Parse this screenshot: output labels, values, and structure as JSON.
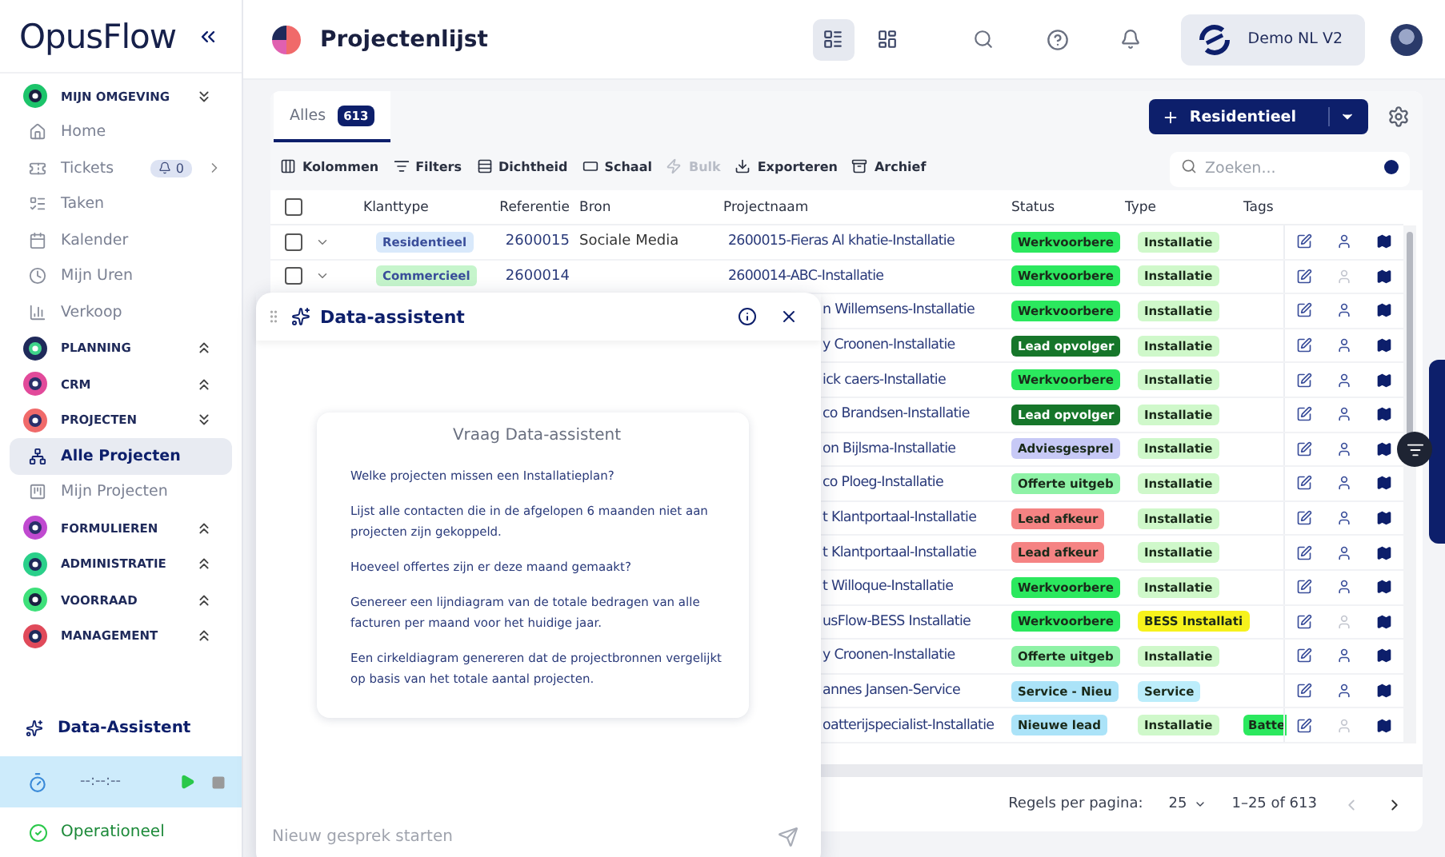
{
  "sidebar": {
    "logo": "OpusFlow",
    "sections": [
      {
        "label": "MIJN OMGEVING",
        "expanded": true,
        "children": [
          {
            "label": "Home",
            "selected": false
          },
          {
            "label": "Tickets",
            "selected": false,
            "badge": "0"
          },
          {
            "label": "Taken",
            "selected": false
          },
          {
            "label": "Kalender",
            "selected": false
          },
          {
            "label": "Mijn Uren",
            "selected": false
          },
          {
            "label": "Verkoop",
            "selected": false
          }
        ]
      },
      {
        "label": "PLANNING",
        "expanded": false
      },
      {
        "label": "CRM",
        "expanded": false
      },
      {
        "label": "PROJECTEN",
        "expanded": true,
        "children": [
          {
            "label": "Alle Projecten",
            "selected": true
          },
          {
            "label": "Mijn Projecten",
            "selected": false
          }
        ]
      },
      {
        "label": "FORMULIEREN",
        "expanded": false
      },
      {
        "label": "ADMINISTRATIE",
        "expanded": false
      },
      {
        "label": "VOORRAAD",
        "expanded": false
      },
      {
        "label": "MANAGEMENT",
        "expanded": false
      }
    ],
    "assistant": "Data-Assistent",
    "timer": "--:--:--",
    "status": "Operationeel"
  },
  "header": {
    "title": "Projectenlijst",
    "views": [
      {
        "selected": true
      },
      {
        "selected": false
      }
    ],
    "org": "Demo NL V2"
  },
  "tabs": [
    {
      "label": "Alles",
      "count": "613",
      "selected": true
    }
  ],
  "new_button": "Residentieel",
  "toolbar": [
    {
      "label": "Kolommen",
      "disabled": false
    },
    {
      "label": "Filters",
      "disabled": false
    },
    {
      "label": "Dichtheid",
      "disabled": false
    },
    {
      "label": "Schaal",
      "disabled": false
    },
    {
      "label": "Bulk",
      "disabled": true
    },
    {
      "label": "Exporteren",
      "disabled": false
    },
    {
      "label": "Archief",
      "disabled": false
    }
  ],
  "search": {
    "placeholder": "Zoeken..."
  },
  "table": {
    "select_all": {
      "checked": false
    },
    "columns": [
      "Klanttype",
      "Referentie",
      "Bron",
      "Projectnaam",
      "Status",
      "Type",
      "Tags"
    ],
    "rows": [
      {
        "kind": "full",
        "checked": false,
        "expanded": false,
        "klanttype": {
          "label": "Residentieel",
          "color": "#d9e9fb"
        },
        "referentie": "2600015",
        "bron": "Sociale Media",
        "project": "2600015-Fieras Al khatie-Installatie",
        "status": {
          "label": "Werkvoorbere",
          "color": "#2be85e"
        },
        "type": {
          "label": "Installatie",
          "color": "#cff8ca"
        },
        "assignee_active": true
      },
      {
        "kind": "full",
        "checked": false,
        "expanded": false,
        "klanttype": {
          "label": "Commercieel",
          "color": "#c6f5cc"
        },
        "referentie": "2600014",
        "project": "2600014-ABC-Installatie",
        "status": {
          "label": "Werkvoorbere",
          "color": "#2be85e"
        },
        "type": {
          "label": "Installatie",
          "color": "#cff8ca"
        },
        "assignee_active": false
      },
      {
        "kind": "covered",
        "project": "n Willemsens-Installatie",
        "status": {
          "label": "Werkvoorbere",
          "color": "#2be85e"
        },
        "type": {
          "label": "Installatie",
          "color": "#cff8ca"
        },
        "assignee_active": true
      },
      {
        "kind": "covered",
        "project": "y Croonen-Installatie",
        "status": {
          "label": "Lead opvolger",
          "color": "#16762a"
        },
        "type": {
          "label": "Installatie",
          "color": "#cff8ca"
        },
        "assignee_active": true
      },
      {
        "kind": "covered",
        "project": "ick caers-Installatie",
        "status": {
          "label": "Werkvoorbere",
          "color": "#2be85e"
        },
        "type": {
          "label": "Installatie",
          "color": "#cff8ca"
        },
        "assignee_active": true
      },
      {
        "kind": "covered",
        "project": "co Brandsen-Installatie",
        "status": {
          "label": "Lead opvolger",
          "color": "#16762a"
        },
        "type": {
          "label": "Installatie",
          "color": "#cff8ca"
        },
        "assignee_active": true
      },
      {
        "kind": "covered",
        "project": "on Bijlsma-Installatie",
        "status": {
          "label": "Adviesgesprel",
          "color": "#c7c9f6"
        },
        "type": {
          "label": "Installatie",
          "color": "#cff8ca"
        },
        "assignee_active": true
      },
      {
        "kind": "covered",
        "project": "co Ploeg-Installatie",
        "status": {
          "label": "Offerte uitgeb",
          "color": "#8ef2a6"
        },
        "type": {
          "label": "Installatie",
          "color": "#cff8ca"
        },
        "assignee_active": true
      },
      {
        "kind": "covered",
        "project": "t Klantportaal-Installatie",
        "status": {
          "label": "Lead afkeur",
          "color": "#f58383"
        },
        "type": {
          "label": "Installatie",
          "color": "#cff8ca"
        },
        "assignee_active": true
      },
      {
        "kind": "covered",
        "project": "t Klantportaal-Installatie",
        "status": {
          "label": "Lead afkeur",
          "color": "#f58383"
        },
        "type": {
          "label": "Installatie",
          "color": "#cff8ca"
        },
        "assignee_active": true
      },
      {
        "kind": "covered",
        "project": "t Willoque-Installatie",
        "status": {
          "label": "Werkvoorbere",
          "color": "#2be85e"
        },
        "type": {
          "label": "Installatie",
          "color": "#cff8ca"
        },
        "assignee_active": true
      },
      {
        "kind": "covered",
        "project": "usFlow-BESS Installatie",
        "status": {
          "label": "Werkvoorbere",
          "color": "#2be85e"
        },
        "type": {
          "label": "BESS Installati",
          "color": "#f6f21c"
        },
        "assignee_active": false
      },
      {
        "kind": "covered",
        "project": "y Croonen-Installatie",
        "status": {
          "label": "Offerte uitgeb",
          "color": "#8ef2a6"
        },
        "type": {
          "label": "Installatie",
          "color": "#cff8ca"
        },
        "assignee_active": true
      },
      {
        "kind": "covered",
        "project": "annes Jansen-Service",
        "status": {
          "label": "Service - Nieu",
          "color": "#abe3f8"
        },
        "type": {
          "label": "Service",
          "color": "#bcedfb"
        },
        "assignee_active": true
      },
      {
        "kind": "covered",
        "project": "oatterijspecialist-Installatie",
        "status": {
          "label": "Nieuwe lead",
          "color": "#abe3f8"
        },
        "type": {
          "label": "Installatie",
          "color": "#cff8ca"
        },
        "tag": {
          "label": "Batte",
          "color": "#2be85e"
        },
        "assignee_active": false
      }
    ]
  },
  "pagination": {
    "label": "Regels per pagina:",
    "per_page": "25",
    "range": "1–25 of 613",
    "prev_disabled": true
  },
  "assistant_dialog": {
    "title": "Data-assistent",
    "card_title": "Vraag Data-assistent",
    "questions": [
      "Welke projecten missen een Installatieplan?",
      "Lijst alle contacten die in de afgelopen 6 maanden niet aan projecten zijn gekoppeld.",
      "Hoeveel offertes zijn er deze maand gemaakt?",
      "Genereer een lijndiagram van de totale bedragen van alle facturen per maand voor het huidige jaar.",
      "Een cirkeldiagram genereren dat de projectbronnen vergelijkt op basis van het totale aantal projecten."
    ],
    "input": {
      "placeholder": "Nieuw gesprek starten"
    }
  }
}
